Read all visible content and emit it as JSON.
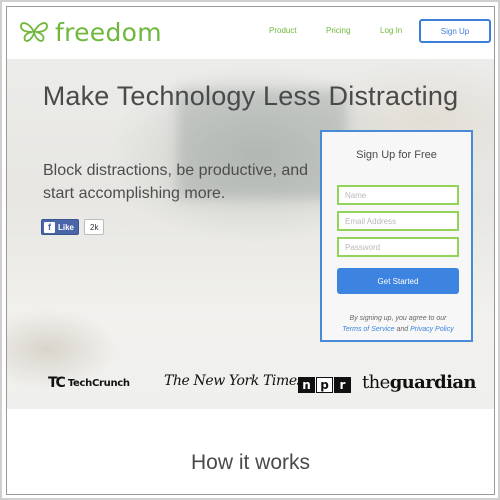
{
  "header": {
    "logo_text": "freedom",
    "logo_icon": "butterfly-icon",
    "nav": {
      "product": "Product",
      "pricing": "Pricing",
      "login": "Log In",
      "signup": "Sign Up"
    }
  },
  "hero": {
    "title": "Make Technology Less Distracting",
    "subtitle": "Block distractions, be productive, and start accomplishing more.",
    "like": {
      "label": "Like",
      "count": "2k"
    }
  },
  "signup_form": {
    "title": "Sign Up for Free",
    "name_placeholder": "Name",
    "email_placeholder": "Email Address",
    "password_placeholder": "Password",
    "submit_label": "Get Started",
    "terms_prefix": "By signing up, you agree to our",
    "terms_link": "Terms of Service",
    "terms_and": "and",
    "privacy_link": "Privacy Policy"
  },
  "press": {
    "techcrunch_mark": "TC",
    "techcrunch": "TechCrunch",
    "nyt": "The New York Times",
    "npr": [
      "n",
      "p",
      "r"
    ],
    "guardian_prefix": "the",
    "guardian_suffix": "guardian"
  },
  "how_it_works": {
    "title": "How it works"
  },
  "colors": {
    "brand_green": "#6fb83b",
    "accent_blue": "#3d84e0",
    "field_border_green": "#94d35a",
    "text_dark": "#4a4a4a"
  }
}
